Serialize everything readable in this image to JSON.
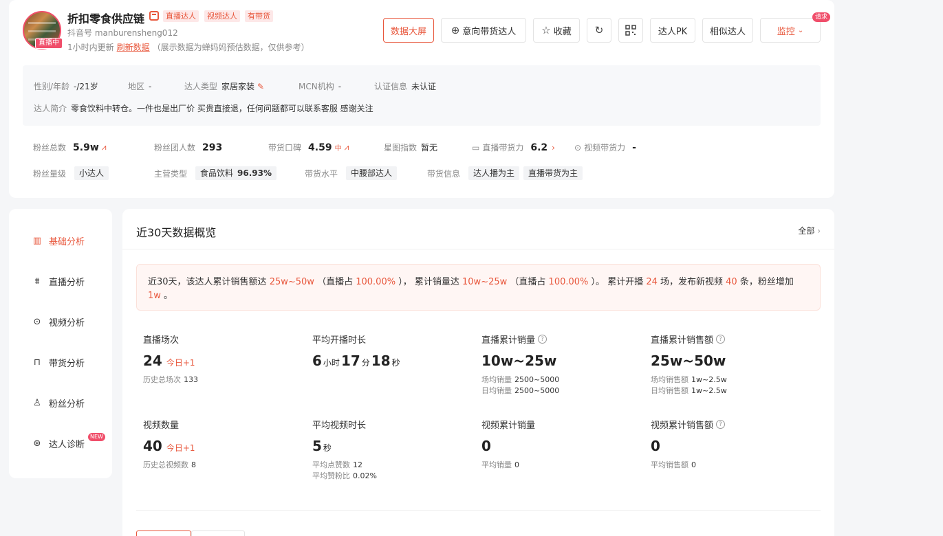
{
  "header": {
    "name": "折扣零食供应链",
    "tags": [
      "直播达人",
      "视频达人",
      "有带货"
    ],
    "douyin_id": "抖音号 manburensheng012",
    "live_badge": "直播中",
    "update_text": "1小时内更新",
    "refresh_label": "刷新数据",
    "update_note": "（展示数据为蝉妈妈预估数据，仅供参考）",
    "buttons": {
      "data_screen": "数据大屏",
      "intent": "意向带货达人",
      "favorite": "收藏",
      "pk": "达人PK",
      "similar": "相似达人",
      "monitor": "监控",
      "request_badge": "请求"
    }
  },
  "info": {
    "gender_age_label": "性别/年龄",
    "gender_age": "-/21岁",
    "region_label": "地区",
    "region": "-",
    "type_label": "达人类型",
    "type": "家居家装",
    "mcn_label": "MCN机构",
    "mcn": "-",
    "cert_label": "认证信息",
    "cert": "未认证",
    "bio_label": "达人简介",
    "bio": "零食饮料中转仓。一件也是出厂价 买贵直接退，任何问题都可以联系客服 感谢关注"
  },
  "stats": {
    "fans_label": "粉丝总数",
    "fans": "5.9w",
    "fan_group_label": "粉丝团人数",
    "fan_group": "293",
    "reputation_label": "带货口碑",
    "reputation": "4.59",
    "reputation_level": "中",
    "star_label": "星图指数",
    "star": "暂无",
    "live_power_label": "直播带货力",
    "live_power": "6.2",
    "video_power_label": "视频带货力",
    "video_power": "-",
    "fan_level_label": "粉丝量级",
    "fan_level": "小达人",
    "main_cat_label": "主营类型",
    "main_cat": "食品饮料",
    "main_cat_pct": "96.93%",
    "level_label": "带货水平",
    "level": "中腰部达人",
    "sell_info_label": "带货信息",
    "sell_info": [
      "达人播为主",
      "直播带货为主"
    ]
  },
  "nav": [
    {
      "label": "基础分析",
      "icon": "bar-chart-icon"
    },
    {
      "label": "直播分析",
      "icon": "live-icon"
    },
    {
      "label": "视频分析",
      "icon": "play-icon"
    },
    {
      "label": "带货分析",
      "icon": "bag-icon"
    },
    {
      "label": "粉丝分析",
      "icon": "user-icon"
    },
    {
      "label": "达人诊断",
      "icon": "pulse-icon"
    }
  ],
  "nav_new_badge": "NEW",
  "main": {
    "title": "近30天数据概览",
    "all_link": "全部",
    "summary": {
      "p1": "近30天，该达人累计销售额达",
      "sales": "25w~50w",
      "p2": "（直播占",
      "sales_live_pct": "100.00%",
      "p3": "），  累计销量达",
      "volume": "10w~25w",
      "p4": "（直播占",
      "volume_live_pct": "100.00%",
      "p5": "）。 累计开播",
      "live_count": "24",
      "p6": "场，发布新视频",
      "video_count": "40",
      "p7": "条，粉丝增加",
      "fans_add": "1w",
      "p8": "。"
    },
    "metrics": {
      "live_sessions": {
        "title": "直播场次",
        "value": "24",
        "today": "今日+1",
        "sub_label": "历史总场次",
        "sub_value": "133"
      },
      "avg_live_duration": {
        "title": "平均开播时长",
        "h": "6",
        "h_unit": "小时",
        "m": "17",
        "m_unit": "分",
        "s": "18",
        "s_unit": "秒"
      },
      "live_volume": {
        "title": "直播累计销量",
        "value": "10w~25w",
        "sub1_label": "场均销量",
        "sub1_value": "2500~5000",
        "sub2_label": "日均销量",
        "sub2_value": "2500~5000"
      },
      "live_sales": {
        "title": "直播累计销售额",
        "value": "25w~50w",
        "sub1_label": "场均销售额",
        "sub1_value": "1w~2.5w",
        "sub2_label": "日均销售额",
        "sub2_value": "1w~2.5w"
      },
      "video_count": {
        "title": "视频数量",
        "value": "40",
        "today": "今日+1",
        "sub_label": "历史总视频数",
        "sub_value": "8"
      },
      "avg_video_duration": {
        "title": "平均视频时长",
        "value": "5",
        "unit": "秒",
        "sub1_label": "平均点赞数",
        "sub1_value": "12",
        "sub2_label": "平均赞粉比",
        "sub2_value": "0.02%"
      },
      "video_volume": {
        "title": "视频累计销量",
        "value": "0",
        "sub_label": "平均销量",
        "sub_value": "0"
      },
      "video_sales": {
        "title": "视频累计销售额",
        "value": "0",
        "sub_label": "平均销售额",
        "sub_value": "0"
      }
    }
  }
}
